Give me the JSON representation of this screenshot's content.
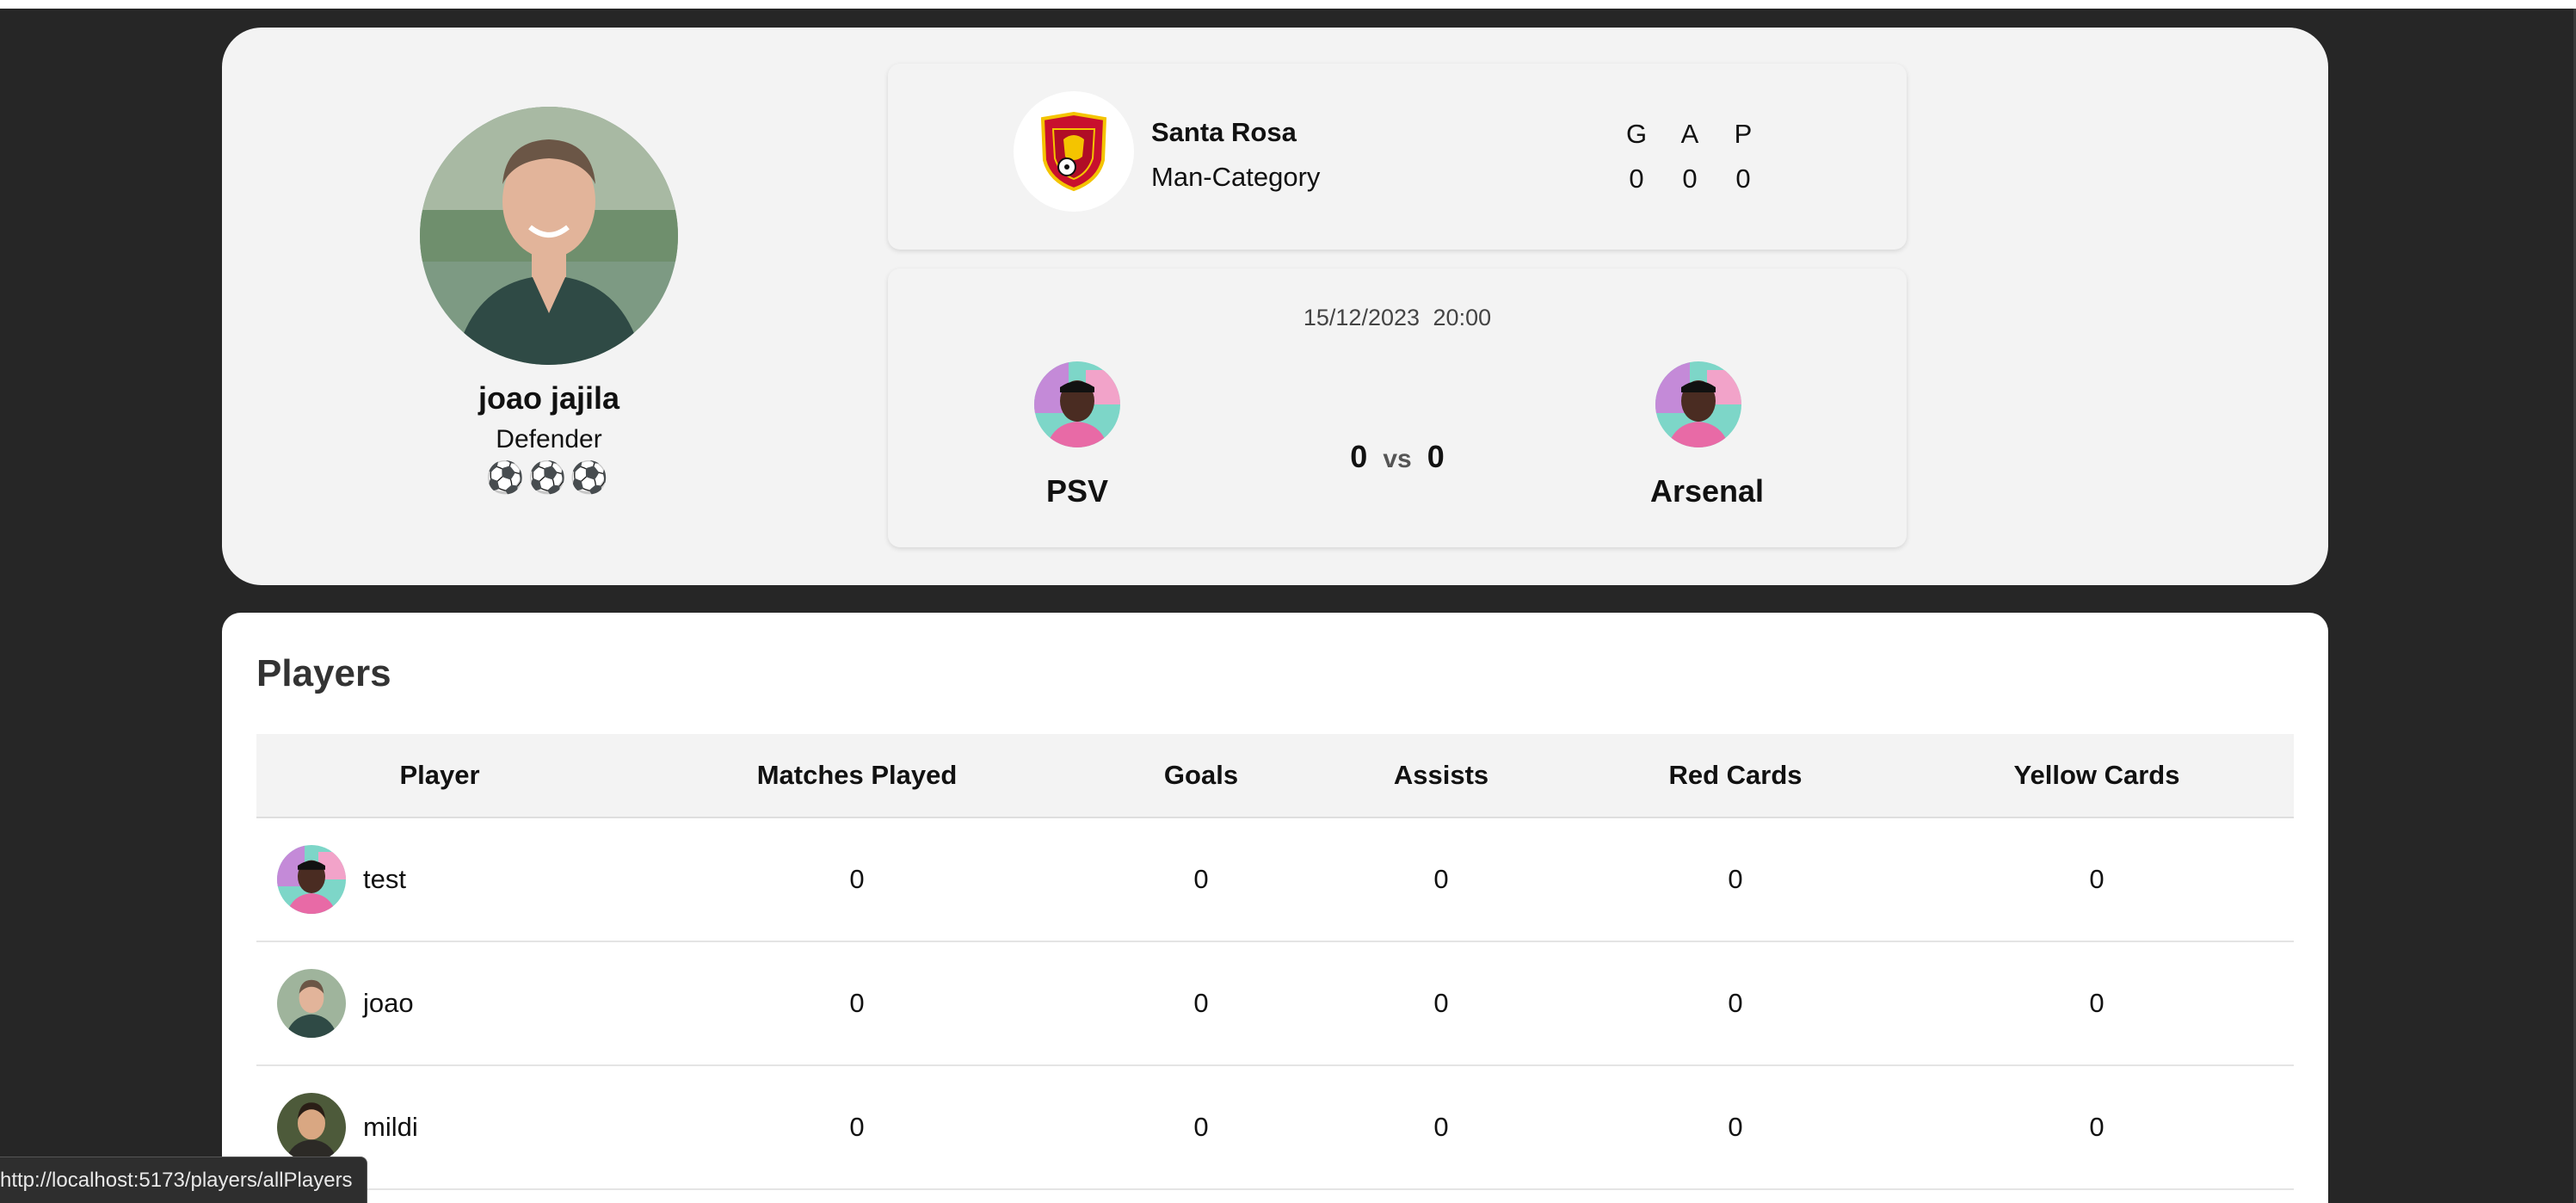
{
  "profile": {
    "name": "joao jajila",
    "position": "Defender",
    "balls": "⚽⚽⚽"
  },
  "team": {
    "name": "Santa Rosa",
    "category": "Man-Category",
    "stats": [
      {
        "label": "G",
        "value": "0"
      },
      {
        "label": "A",
        "value": "0"
      },
      {
        "label": "P",
        "value": "0"
      }
    ]
  },
  "match": {
    "date": "15/12/2023",
    "time": "20:00",
    "home_team": "PSV",
    "away_team": "Arsenal",
    "home_score": "0",
    "vs": "vs",
    "away_score": "0"
  },
  "players": {
    "title": "Players",
    "columns": [
      "Player",
      "Matches Played",
      "Goals",
      "Assists",
      "Red Cards",
      "Yellow Cards"
    ],
    "rows": [
      {
        "name": "test",
        "matches": "0",
        "goals": "0",
        "assists": "0",
        "red": "0",
        "yellow": "0"
      },
      {
        "name": "joao",
        "matches": "0",
        "goals": "0",
        "assists": "0",
        "red": "0",
        "yellow": "0"
      },
      {
        "name": "mildi",
        "matches": "0",
        "goals": "0",
        "assists": "0",
        "red": "0",
        "yellow": "0"
      }
    ]
  },
  "status_bar": {
    "url": "http://localhost:5173/players/allPlayers"
  }
}
